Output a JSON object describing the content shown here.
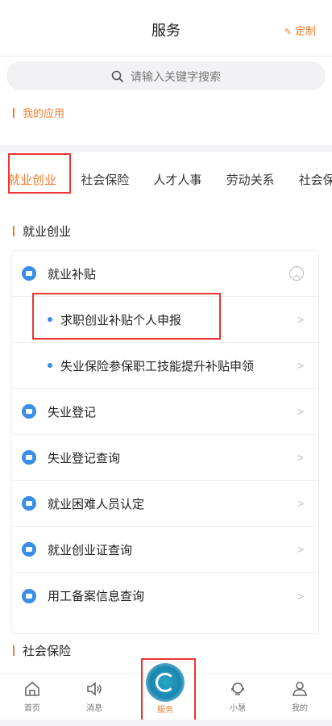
{
  "header": {
    "title": "服务",
    "customize": "定制"
  },
  "search": {
    "placeholder": "请输入关键字搜索"
  },
  "my_apps": {
    "title": "我的应用"
  },
  "tabs": [
    {
      "label": "就业创业",
      "active": true
    },
    {
      "label": "社会保险"
    },
    {
      "label": "人才人事"
    },
    {
      "label": "劳动关系"
    },
    {
      "label": "社会保"
    }
  ],
  "section_employment": {
    "title": "就业创业"
  },
  "card": {
    "group": {
      "label": "就业补贴"
    },
    "sub_items": [
      {
        "label": "求职创业补贴个人申报"
      },
      {
        "label": "失业保险参保职工技能提升补贴申领"
      }
    ],
    "items": [
      {
        "label": "失业登记"
      },
      {
        "label": "失业登记查询"
      },
      {
        "label": "就业困难人员认定"
      },
      {
        "label": "就业创业证查询"
      },
      {
        "label": "用工备案信息查询"
      }
    ]
  },
  "section_social": {
    "title": "社会保险"
  },
  "nav": [
    {
      "label": "首页"
    },
    {
      "label": "消息"
    },
    {
      "label": "服务",
      "active": true
    },
    {
      "label": "小慧"
    },
    {
      "label": "我的"
    }
  ],
  "colors": {
    "accent": "#f07d2b",
    "icon_blue": "#3a8ee6",
    "highlight": "#ee3333"
  }
}
